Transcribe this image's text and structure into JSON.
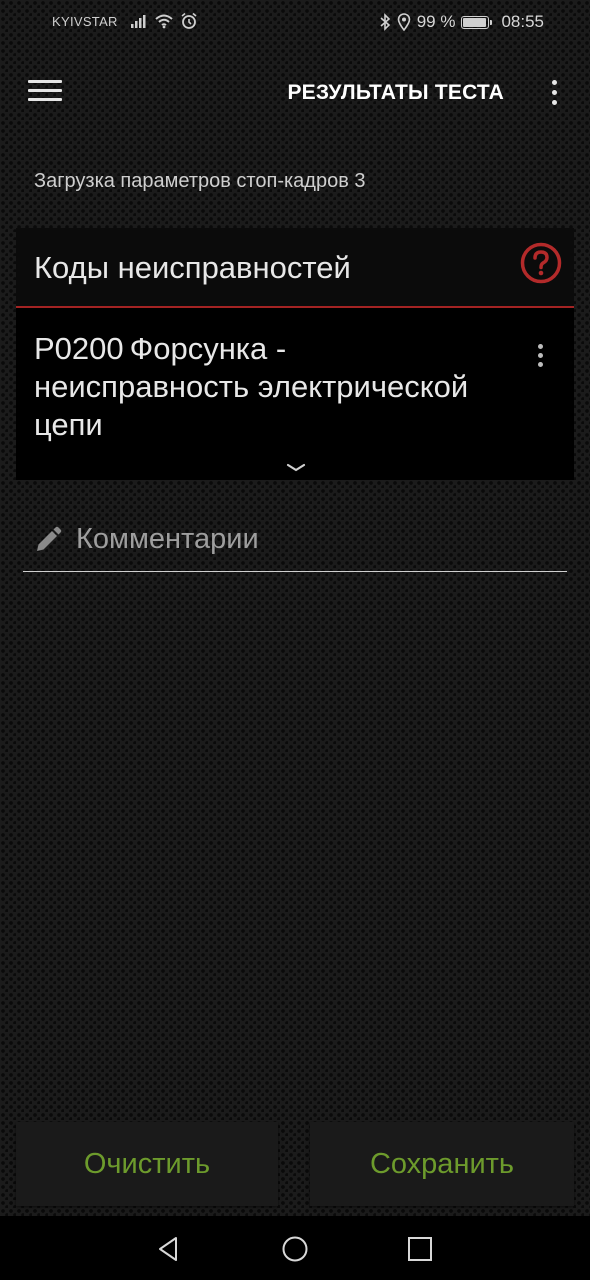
{
  "status_bar": {
    "carrier": "KYIVSTAR",
    "battery_percent": "99 %",
    "time": "08:55"
  },
  "app_bar": {
    "title": "РЕЗУЛЬТАТЫ ТЕСТА"
  },
  "subtitle": "Загрузка параметров стоп-кадров 3",
  "fault_card": {
    "title": "Коды неисправностей",
    "header_accent": "#a32323",
    "dtc": {
      "code": "P0200",
      "description": "Форсунка - неисправность электрической цепи"
    }
  },
  "comment": {
    "placeholder": "Комментарии"
  },
  "buttons": {
    "clear": "Очистить",
    "save": "Сохранить",
    "color": "#6d9b2c"
  },
  "icons": {
    "menu": "hamburger-menu-icon",
    "overflow": "more-vert-icon",
    "help": "help-circle-icon",
    "edit": "pencil-icon",
    "expand": "chevron-down-icon"
  }
}
